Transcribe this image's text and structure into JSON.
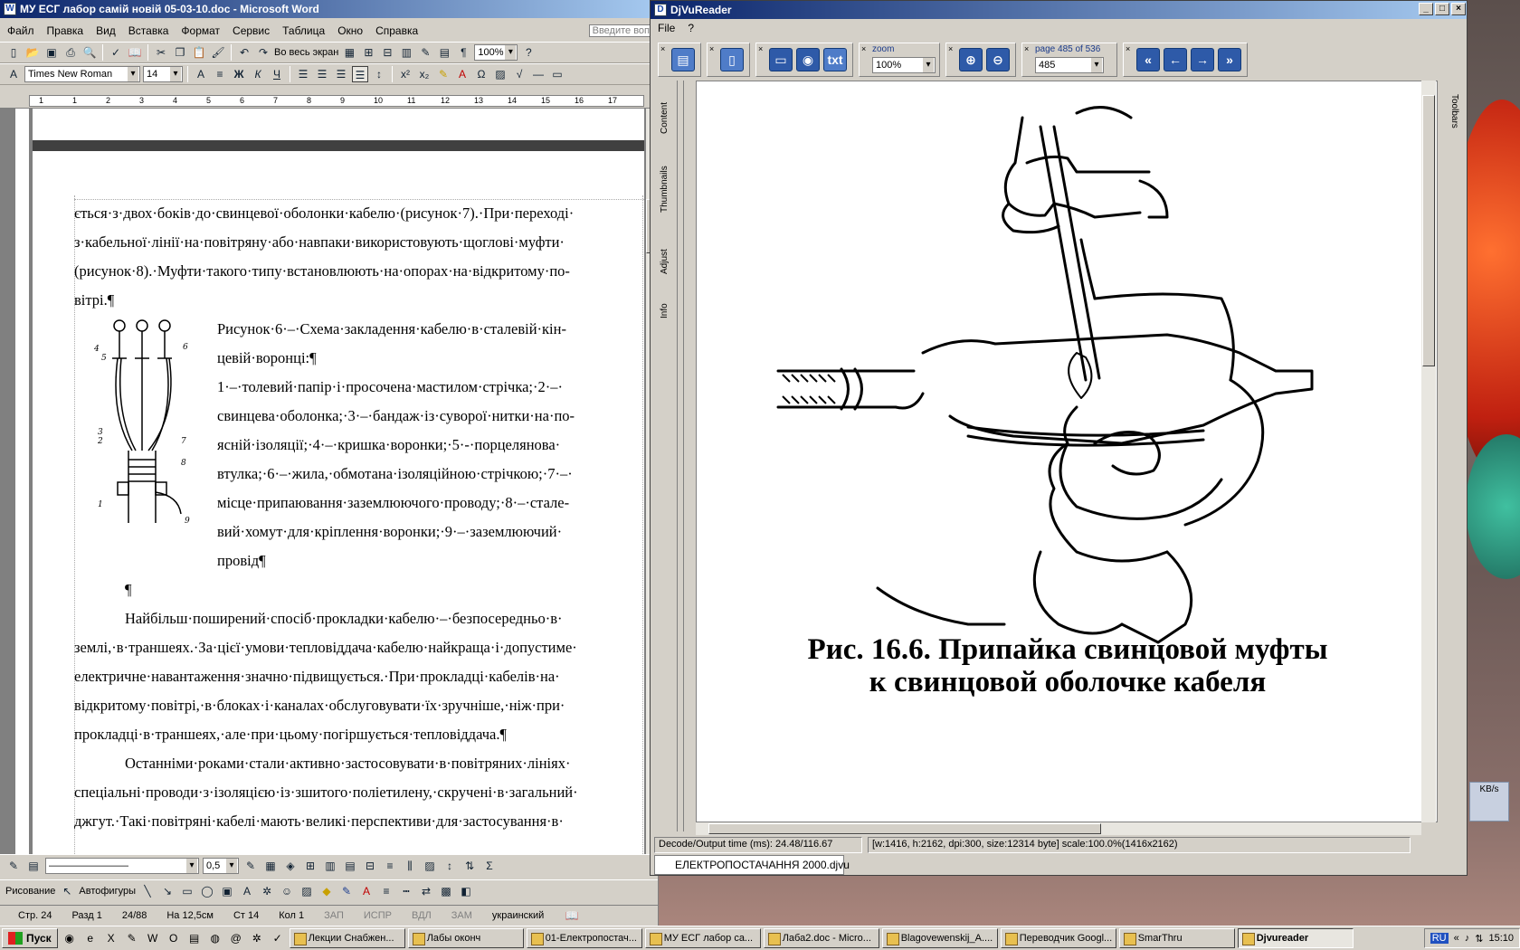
{
  "word": {
    "title": "МУ ЕСГ лабор самій новій 05-03-10.doc - Microsoft Word",
    "menu": [
      "Файл",
      "Правка",
      "Вид",
      "Вставка",
      "Формат",
      "Сервис",
      "Таблица",
      "Окно",
      "Справка"
    ],
    "help_placeholder": "Введите воп",
    "fullscreen_label": "Во весь экран",
    "zoom": "100%",
    "font": "Times New Roman",
    "size": "14",
    "ruler_numbers": [
      "1",
      "1",
      "2",
      "3",
      "4",
      "5",
      "6",
      "7",
      "8",
      "9",
      "10",
      "11",
      "12",
      "13",
      "14",
      "15",
      "16",
      "17"
    ],
    "lines_top": [
      "ється·з·двох·боків·до·свинцевої·оболонки·кабелю·(рисунок·7).·При·переході·",
      "з·кабельної·лінії·на·повітряну·або·навпаки·використовують·щоглові·муфти·",
      "(рисунок·8).·Муфти·такого·типу·встановлюють·на·опорах·на·відкритому·по-",
      "вітрі.¶"
    ],
    "fig_lines": [
      "Рисунок·6·–·Схема·закладення·кабелю·в·сталевій·кін-",
      "цевій·воронці:¶",
      "1·–·толевий·папір·і·просочена·мастилом·стрічка;·2·–·",
      "свинцева·оболонка;·3·–·бандаж·із·суворої·нитки·на·по-",
      "ясній·ізоляції;·4·–·кришка·воронки;·5·-·порцелянова·",
      "втулка;·6·–·жила,·обмотана·ізоляційною·стрічкою;·7·–·",
      "місце·припаювання·заземлюючого·проводу;·8·–·стале-",
      "вий·хомут·для·кріплення·воронки;·9·–·заземлюючий·",
      "провід¶"
    ],
    "empty_para": "¶",
    "lines_bottom": [
      "Найбільш·поширений·спосіб·прокладки·кабелю·–·безпосередньо·в·",
      "землі,·в·траншеях.·За·цієї·умови·тепловіддача·кабелю·найкраща·і·допустиме·",
      "електричне·навантаження·значно·підвищується.·При·прокладці·кабелів·на·",
      "відкритому·повітрі,·в·блоках·і·каналах·обслуговувати·їх·зручніше,·ніж·при·",
      "прокладці·в·траншеях,·але·при·цьому·погіршується·тепловіддача.¶",
      "Останніми·роками·стали·активно·застосовувати·в·повітряних·лініях·",
      "спеціальні·проводи·з·ізоляцією·із·зшитого·поліетилену,·скручені·в·загальний·",
      "джгут.·Такі·повітряні·кабелі·мають·великі·перспективи·для·застосування·в·"
    ],
    "fig_numbers": [
      "4",
      "5",
      "6",
      "3",
      "2",
      "7",
      "8",
      "1",
      "9"
    ],
    "line_width": "0,5",
    "draw_label": "Рисование",
    "autoshapes_label": "Автофигуры",
    "status": {
      "page": "Стр. 24",
      "section": "Разд 1",
      "pages": "24/88",
      "at": "На 12,5см",
      "line": "Ст 14",
      "col": "Кол 1",
      "rec": "ЗАП",
      "trk": "ИСПР",
      "ext": "ВДЛ",
      "ovr": "ЗАМ",
      "lang": "украинский"
    }
  },
  "djvu": {
    "title": "DjVuReader",
    "menu": [
      "File",
      "?"
    ],
    "zoom_label": "zoom",
    "zoom_value": "100%",
    "page_label": "page 485 of 536",
    "page_value": "485",
    "side_tabs": [
      "Content",
      "Thumbnails",
      "Adjust",
      "Info"
    ],
    "right_tab": "Toolbars",
    "caption_line1": "Рис. 16.6. Припайка свинцовой муфты",
    "caption_line2": "к свинцовой оболочке кабеля",
    "status_left": "Decode/Output time (ms): 24.48/116.67",
    "status_right": "[w:1416, h:2162, dpi:300, size:12314 byte] scale:100.0%(1416x2162)",
    "doc_tab": "ЕЛЕКТРОПОСТАЧАННЯ 2000.djvu"
  },
  "desktop": {
    "speed": "KB/s"
  },
  "taskbar": {
    "start": "Пуск",
    "tasks": [
      "Лекции Снабжен...",
      "Лабы оконч",
      "01-Електропостач...",
      "МУ ЕСГ лабор са...",
      "Лаба2.doc - Micro...",
      "Blagovewenskij_A....",
      "Переводчик Googl...",
      "SmarThru",
      "Djvureader"
    ],
    "lang": "RU",
    "time": "15:10"
  }
}
